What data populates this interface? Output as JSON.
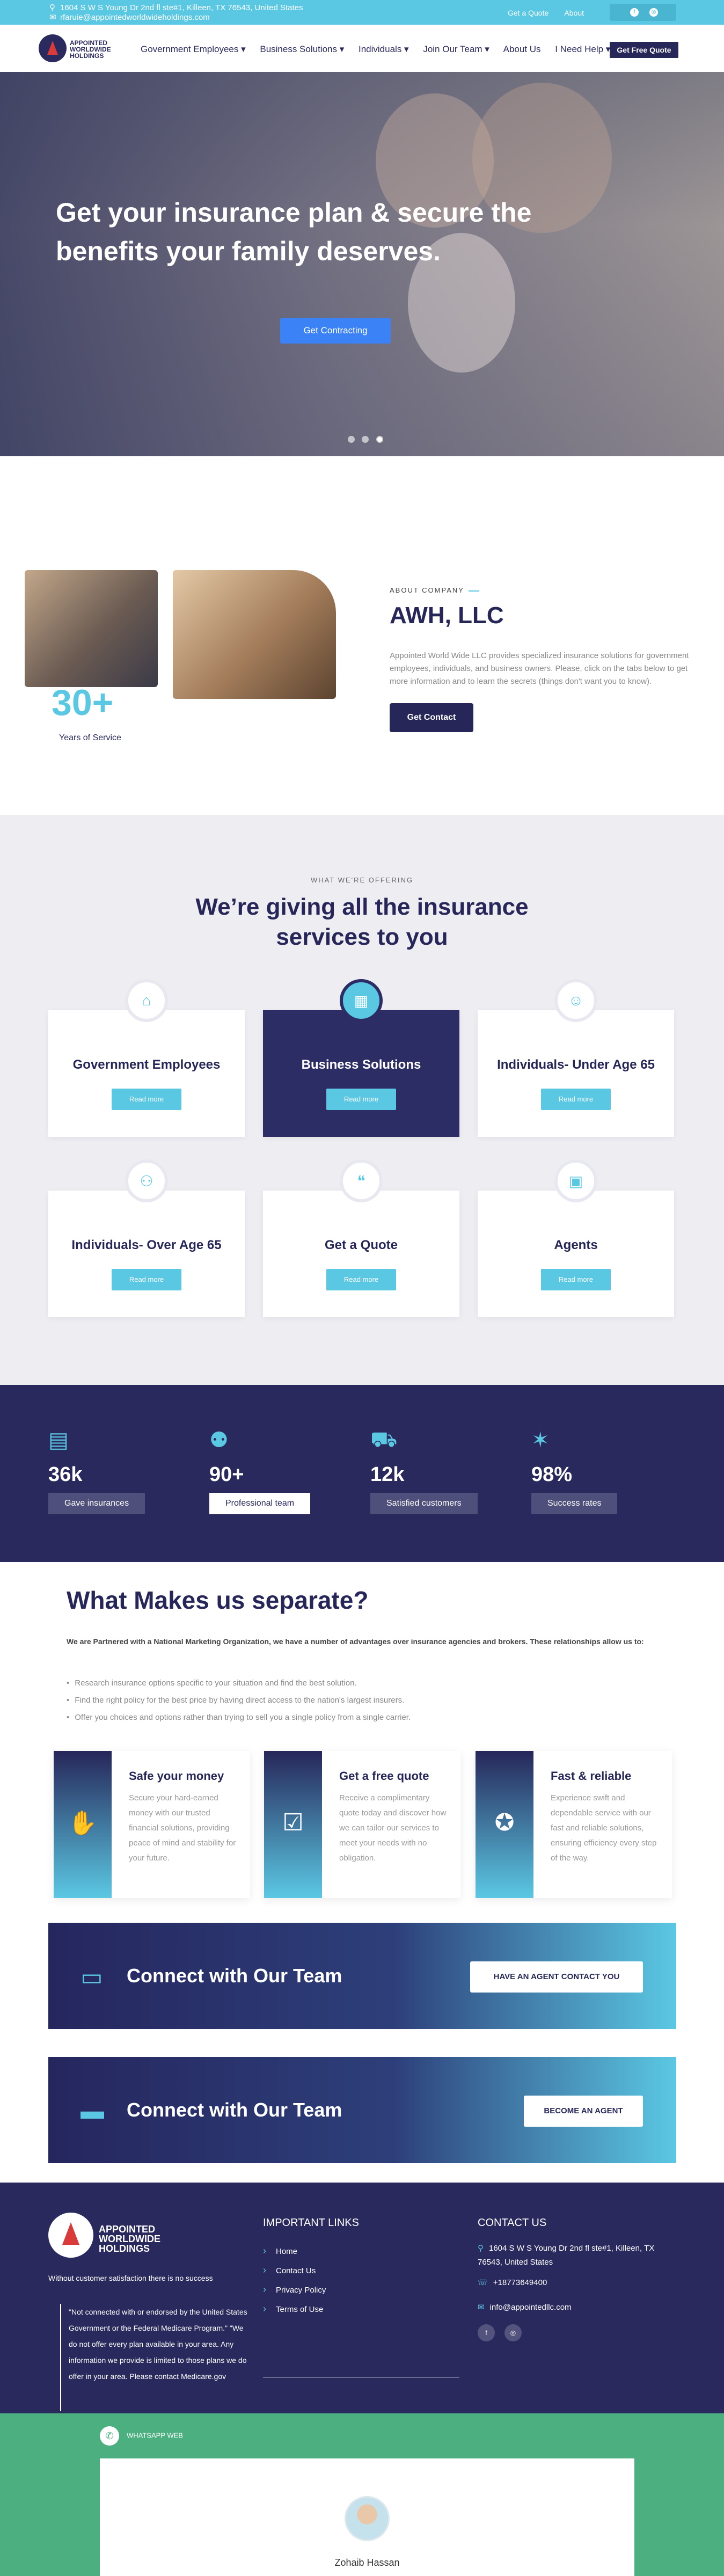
{
  "topbar": {
    "address": "1604 S W S Young Dr 2nd fl ste#1, Killeen, TX 76543, United States",
    "email": "rfaruie@appointedworldwideholdings.com",
    "links": [
      "Get a Quote",
      "About"
    ]
  },
  "header": {
    "logo_text": [
      "APPOINTED",
      "WORLDWIDE",
      "HOLDINGS"
    ],
    "nav": [
      "Government Employees ▾",
      "Business Solutions ▾",
      "Individuals ▾",
      "Join Our Team ▾",
      "About Us",
      "I Need Help ▾"
    ],
    "quote_button": "Get Free Quote"
  },
  "hero": {
    "title": "Get your insurance plan & secure the benefits your family deserves.",
    "cta": "Get Contracting",
    "slides": 3,
    "active_slide": 3
  },
  "about": {
    "years": "30+",
    "years_label": "Years of Service",
    "tag": "ABOUT COMPANY",
    "title": "AWH, LLC",
    "text": "Appointed World Wide LLC provides specialized insurance solutions for government employees, individuals, and business owners. Please, click on the tabs below to get more information and to learn the secrets (things don't want you to know).",
    "button": "Get Contact"
  },
  "services": {
    "tag": "WHAT WE'RE OFFERING",
    "title": "We’re giving all the insurance services to you",
    "read_more": "Read more",
    "cards": [
      {
        "title": "Government Employees",
        "icon": "home-icon"
      },
      {
        "title": "Business Solutions",
        "icon": "building-icon"
      },
      {
        "title": "Individuals- Under Age 65",
        "icon": "person-icon"
      },
      {
        "title": "Individuals- Over Age 65",
        "icon": "people-icon"
      },
      {
        "title": "Get a Quote",
        "icon": "quote-icon"
      },
      {
        "title": "Agents",
        "icon": "briefcase-icon"
      }
    ]
  },
  "stats": [
    {
      "num": "36k",
      "label": "Gave insurances"
    },
    {
      "num": "90+",
      "label": "Professional team"
    },
    {
      "num": "12k",
      "label": "Satisfied customers"
    },
    {
      "num": "98%",
      "label": "Success rates"
    }
  ],
  "separate": {
    "title": "What Makes us separate?",
    "intro": "We are Partnered with a National Marketing Organization, we have a number of advantages over insurance agencies and brokers. These relationships allow us to:",
    "bullets": [
      "Research insurance options specific to your situation and find the best solution.",
      "Find the right policy for the best price by having direct access to the nation's largest insurers.",
      "Offer you choices and options rather than trying to sell you a single policy from a single carrier."
    ],
    "cards": [
      {
        "title": "Safe your money",
        "text": "Secure your hard-earned money with our trusted financial solutions, providing peace of mind and stability for your future."
      },
      {
        "title": "Get a free quote",
        "text": "Receive a complimentary quote today and discover how we can tailor our services to meet your needs with no obligation."
      },
      {
        "title": "Fast & reliable",
        "text": "Experience swift and dependable service with our fast and reliable solutions, ensuring efficiency every step of the way."
      }
    ]
  },
  "connect": [
    {
      "title": "Connect with Our Team",
      "button": "HAVE AN AGENT CONTACT YOU"
    },
    {
      "title": "Connect with Our Team",
      "button": "BECOME AN AGENT"
    }
  ],
  "footer": {
    "logo_text": [
      "APPOINTED",
      "WORLDWIDE",
      "HOLDINGS"
    ],
    "tagline": "Without customer satisfaction there is no success",
    "disclaimer": "\"Not connected with or endorsed by the United States Government or the Federal Medicare Program.\" \"We do not offer every plan available in your area. Any information we provide is limited to those plans we do offer in your area. Please contact Medicare.gov",
    "links_title": "IMPORTANT LINKS",
    "links": [
      "Home",
      "Contact Us",
      "Privacy Policy",
      "Terms of Use"
    ],
    "contact_title": "CONTACT US",
    "contact_address": "1604 S W S Young Dr 2nd fl ste#1, Killeen, TX 76543, United States",
    "contact_phone": "+18773649400",
    "contact_email": "info@appointedllc.com"
  },
  "whatsapp": {
    "label": "WHATSAPP WEB",
    "agent_name": "Zohaib Hassan"
  },
  "colors": {
    "navy": "#262659",
    "cyan": "#5bc8e3",
    "whatsapp": "#4caf7f"
  }
}
